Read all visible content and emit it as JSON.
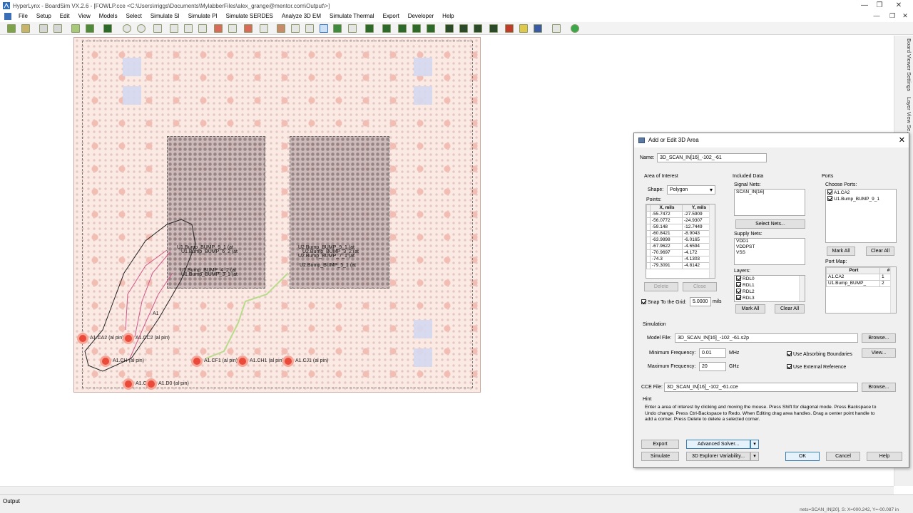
{
  "window": {
    "title": "HyperLynx - BoardSim VX.2.6 - [FOWLP.cce <C:\\Users\\rriggs\\Documents\\MylabberFiles\\alex_grange@mentor.com\\Output\\>]"
  },
  "menu": [
    "File",
    "Setup",
    "Edit",
    "View",
    "Models",
    "Select",
    "Simulate SI",
    "Simulate PI",
    "Simulate SERDES",
    "Analyze 3D EM",
    "Simulate Thermal",
    "Export",
    "Developer",
    "Help"
  ],
  "right_dock_tabs": [
    "Board Viewer Settings",
    "Layer View Se..."
  ],
  "pcb": {
    "bump_labels_left": [
      "U1.Bump_BUMP_9_1 (at",
      "U1.Bump_BUMP_6_2 (at",
      "U1.Bump_BUMP_4_2 (at",
      "U1.Bump_BUMP_3_1 (at"
    ],
    "bump_labels_right": [
      "U2.Bump_BUMP_9_1 (at",
      "U2.Bump_BUMP_3_2 (at",
      "U2.Bump_BUMP_7_1 (at",
      "U2.Bump_BUMP_5_1 (at"
    ],
    "pin_labels": [
      "A1.CA2 (al pin)",
      "A1.CC2 (al pin)",
      "A1.CF1 (al pin)",
      "A1.CH1 (al pin)",
      "A1.CJ1 (al pin)",
      "A1.CH (al pin)",
      "A1.D0 (al pin)",
      "A1.CE0"
    ],
    "label_a1": "A1"
  },
  "dialog": {
    "title": "Add or Edit 3D Area",
    "name_label": "Name:",
    "name_value": "3D_SCAN_IN[16]_-102_-61",
    "area_of_interest": "Area of Interest",
    "shape_label": "Shape:",
    "shape_value": "Polygon",
    "points_label": "Points:",
    "points_headers": [
      "X, mils",
      "Y, mils"
    ],
    "points": [
      [
        "-55.7472",
        "-27.5909"
      ],
      [
        "-56.0772",
        "-24.9307"
      ],
      [
        "-59.148",
        "-12.7449"
      ],
      [
        "-60.8421",
        "-8.9043"
      ],
      [
        "-63.9898",
        "-6.0165"
      ],
      [
        "-67.9622",
        "-4.6594"
      ],
      [
        "-70.9697",
        "-4.172"
      ],
      [
        "-74.3",
        "-4.1303"
      ],
      [
        "-79.3091",
        "-4.8142"
      ]
    ],
    "delete_btn": "Delete",
    "close_btn": "Close",
    "snap_label": "Snap To the Grid:",
    "snap_value": "5.0000",
    "snap_unit": "mils",
    "included_data": "Included Data",
    "signal_nets_label": "Signal Nets:",
    "signal_nets": [
      "SCAN_IN[16]"
    ],
    "select_nets_btn": "Select Nets...",
    "supply_nets_label": "Supply Nets:",
    "supply_nets": [
      "VDD1",
      "VDDPST",
      "VSS"
    ],
    "layers_label": "Layers:",
    "layers": [
      "RDL0",
      "RDL1",
      "RDL2",
      "RDL3"
    ],
    "mark_all": "Mark All",
    "clear_all": "Clear All",
    "ports": "Ports",
    "choose_ports_label": "Choose Ports:",
    "choose_ports": [
      "A1.CA2",
      "U1.Bump_BUMP_9_1"
    ],
    "port_map_label": "Port Map:",
    "port_map_headers": [
      "Port",
      "#"
    ],
    "port_map": [
      [
        "A1.CA2",
        "1"
      ],
      [
        "U1.Bump_BUMP_",
        "2"
      ]
    ],
    "simulation": "Simulation",
    "model_file_label": "Model File:",
    "model_file_value": "3D_SCAN_IN[16]_-102_-61.s2p",
    "browse": "Browse...",
    "view": "View...",
    "min_freq_label": "Minimum Frequency:",
    "min_freq_value": "0.01",
    "min_freq_unit": "MHz",
    "max_freq_label": "Maximum Frequency:",
    "max_freq_value": "20",
    "max_freq_unit": "GHz",
    "use_absorbing": "Use Absorbing Boundaries",
    "use_external": "Use External Reference",
    "cce_label": "CCE File:",
    "cce_value": "3D_SCAN_IN[16]_-102_-61.cce",
    "hint_label": "Hint",
    "hint_text": "Enter a area of interest by clicking and moving the mouse. Press Shift for diagonal mode. Press Backspace to Undo change. Press Ctrl-Backspace to Redo. When Editing drag area handles. Drag a center point handle to add a corner. Press Delete to delete a selected corner.",
    "export_btn": "Export",
    "advanced_btn": "Advanced Solver...",
    "simulate_btn": "Simulate",
    "variability_btn": "3D Explorer Variability...",
    "ok_btn": "OK",
    "cancel_btn": "Cancel",
    "help_btn": "Help"
  },
  "status": {
    "output": "Output",
    "coord": "nets=SCAN_IN[20], S: X=000.242, Y=-00.087 in"
  }
}
